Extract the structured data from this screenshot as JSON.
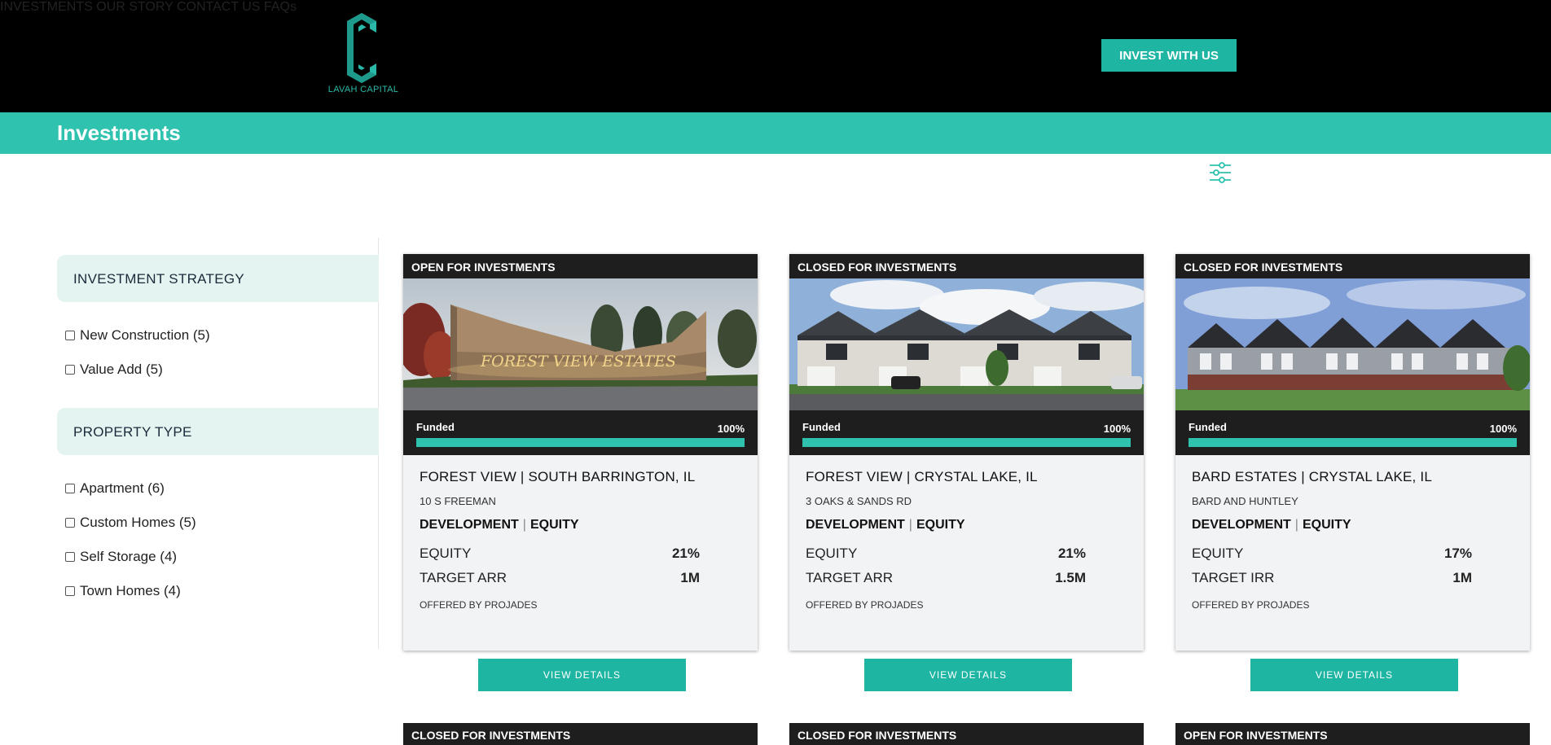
{
  "brand": {
    "name": "LAVAH CAPITAL",
    "accent": "#2fc2ae",
    "button": "#1fb5a3"
  },
  "nav": {
    "items": [
      {
        "label": "INVESTMENTS"
      },
      {
        "label": "OUR STORY"
      },
      {
        "label": "CONTACT US"
      },
      {
        "label": "FAQs"
      }
    ],
    "cta": "INVEST WITH US"
  },
  "page": {
    "title": "Investments"
  },
  "filters": {
    "toggle_icon": "sliders-icon",
    "groups": [
      {
        "title": "INVESTMENT STRATEGY",
        "options": [
          {
            "label": "New Construction (5)",
            "checked": false
          },
          {
            "label": "Value Add (5)",
            "checked": false
          }
        ]
      },
      {
        "title": "PROPERTY TYPE",
        "options": [
          {
            "label": "Apartment (6)",
            "checked": false
          },
          {
            "label": "Custom Homes (5)",
            "checked": false
          },
          {
            "label": "Self Storage (4)",
            "checked": false
          },
          {
            "label": "Town Homes (4)",
            "checked": false
          }
        ]
      }
    ]
  },
  "cards": [
    {
      "status": "OPEN FOR INVESTMENTS",
      "funded_label": "Funded",
      "funded_pct": "100%",
      "funded_fraction": 1.0,
      "name": "FOREST VIEW | SOUTH BARRINGTON, IL",
      "address": "10 S FREEMAN",
      "tag1": "DEVELOPMENT",
      "tag2": "EQUITY",
      "metrics": [
        {
          "label": "EQUITY",
          "value": "21%"
        },
        {
          "label": "TARGET ARR",
          "value": "1M"
        }
      ],
      "offered_by": "OFFERED BY PROJADES",
      "button": "VIEW DETAILS"
    },
    {
      "status": "CLOSED FOR INVESTMENTS",
      "funded_label": "Funded",
      "funded_pct": "100%",
      "funded_fraction": 1.0,
      "name": "FOREST VIEW | CRYSTAL LAKE, IL",
      "address": "3 OAKS & SANDS RD",
      "tag1": "DEVELOPMENT",
      "tag2": "EQUITY",
      "metrics": [
        {
          "label": "EQUITY",
          "value": "21%"
        },
        {
          "label": "TARGET ARR",
          "value": "1.5M"
        }
      ],
      "offered_by": "OFFERED BY PROJADES",
      "button": "VIEW DETAILS"
    },
    {
      "status": "CLOSED FOR INVESTMENTS",
      "funded_label": "Funded",
      "funded_pct": "100%",
      "funded_fraction": 1.0,
      "name": "BARD ESTATES | CRYSTAL LAKE, IL",
      "address": "BARD AND HUNTLEY",
      "tag1": "DEVELOPMENT",
      "tag2": "EQUITY",
      "metrics": [
        {
          "label": "EQUITY",
          "value": "17%"
        },
        {
          "label": "TARGET IRR",
          "value": "1M"
        }
      ],
      "offered_by": "OFFERED BY PROJADES",
      "button": "VIEW DETAILS"
    }
  ],
  "next_row": [
    {
      "status": "CLOSED FOR INVESTMENTS"
    },
    {
      "status": "CLOSED FOR INVESTMENTS"
    },
    {
      "status": "OPEN FOR INVESTMENTS"
    }
  ],
  "sign_text": "FOREST VIEW ESTATES"
}
